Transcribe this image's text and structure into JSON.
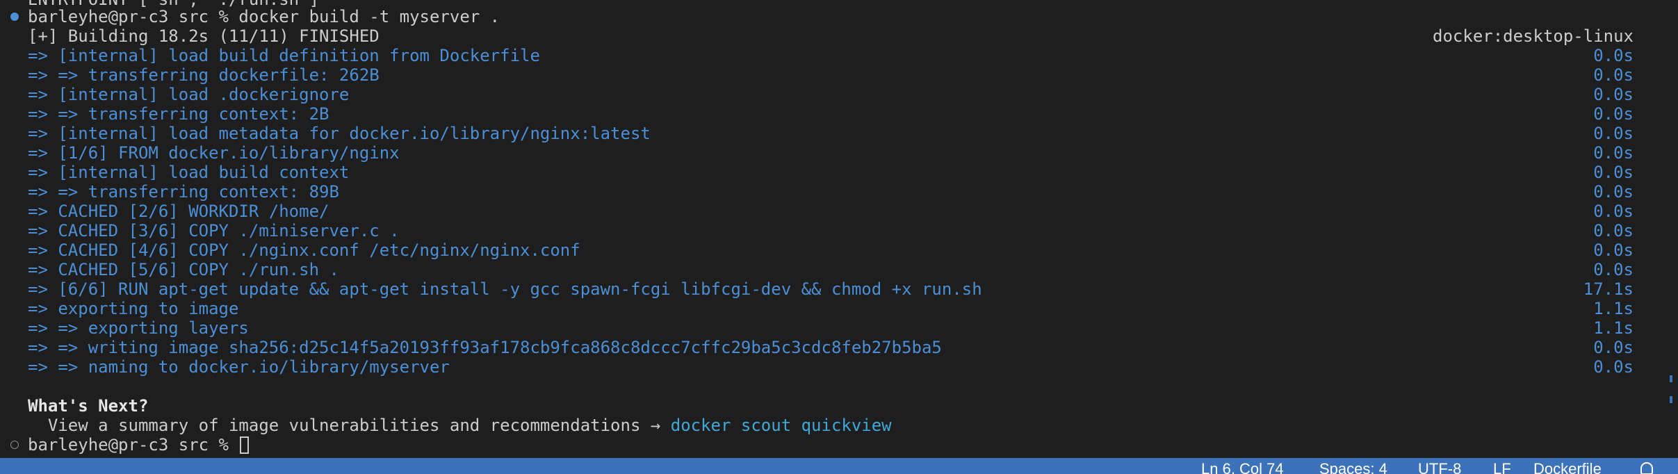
{
  "terminal": {
    "top_partial": "ENTRYPOINT [\"sh\", \"./run.sh\"]",
    "prompt_line": "barleyhe@pr-c3 src % docker build -t myserver .",
    "building": "[+] Building 18.2s (11/11) FINISHED",
    "builder": "docker:desktop-linux",
    "steps": [
      {
        "text": "=> [internal] load build definition from Dockerfile",
        "time": "0.0s"
      },
      {
        "text": "=> => transferring dockerfile: 262B",
        "time": "0.0s"
      },
      {
        "text": "=> [internal] load .dockerignore",
        "time": "0.0s"
      },
      {
        "text": "=> => transferring context: 2B",
        "time": "0.0s"
      },
      {
        "text": "=> [internal] load metadata for docker.io/library/nginx:latest",
        "time": "0.0s"
      },
      {
        "text": "=> [1/6] FROM docker.io/library/nginx",
        "time": "0.0s"
      },
      {
        "text": "=> [internal] load build context",
        "time": "0.0s"
      },
      {
        "text": "=> => transferring context: 89B",
        "time": "0.0s"
      },
      {
        "text": "=> CACHED [2/6] WORKDIR /home/",
        "time": "0.0s"
      },
      {
        "text": "=> CACHED [3/6] COPY ./miniserver.c .",
        "time": "0.0s"
      },
      {
        "text": "=> CACHED [4/6] COPY ./nginx.conf /etc/nginx/nginx.conf",
        "time": "0.0s"
      },
      {
        "text": "=> CACHED [5/6] COPY ./run.sh .",
        "time": "0.0s"
      },
      {
        "text": "=> [6/6] RUN apt-get update && apt-get install -y gcc spawn-fcgi libfcgi-dev && chmod +x run.sh",
        "time": "17.1s"
      },
      {
        "text": "=> exporting to image",
        "time": "1.1s"
      },
      {
        "text": "=> => exporting layers",
        "time": "1.1s"
      },
      {
        "text": "=> => writing image sha256:d25c14f5a20193ff93af178cb9fca868c8dccc7cffc29ba5c3cdc8feb27b5ba5",
        "time": "0.0s"
      },
      {
        "text": "=> => naming to docker.io/library/myserver",
        "time": "0.0s"
      }
    ],
    "whats_next": "What's Next?",
    "summary_prefix": "  View a summary of image vulnerabilities and recommendations → ",
    "summary_link": "docker scout quickview",
    "final_prompt": "barleyhe@pr-c3 src % "
  },
  "statusbar": {
    "position": "Ln 6, Col 74",
    "spaces": "Spaces: 4",
    "encoding": "UTF-8",
    "eol": "LF",
    "language": "Dockerfile"
  },
  "colors": {
    "background": "#1e1e1e",
    "step_text": "#4c8fd6",
    "link": "#3fa8d8",
    "statusbar": "#3b72b9"
  }
}
